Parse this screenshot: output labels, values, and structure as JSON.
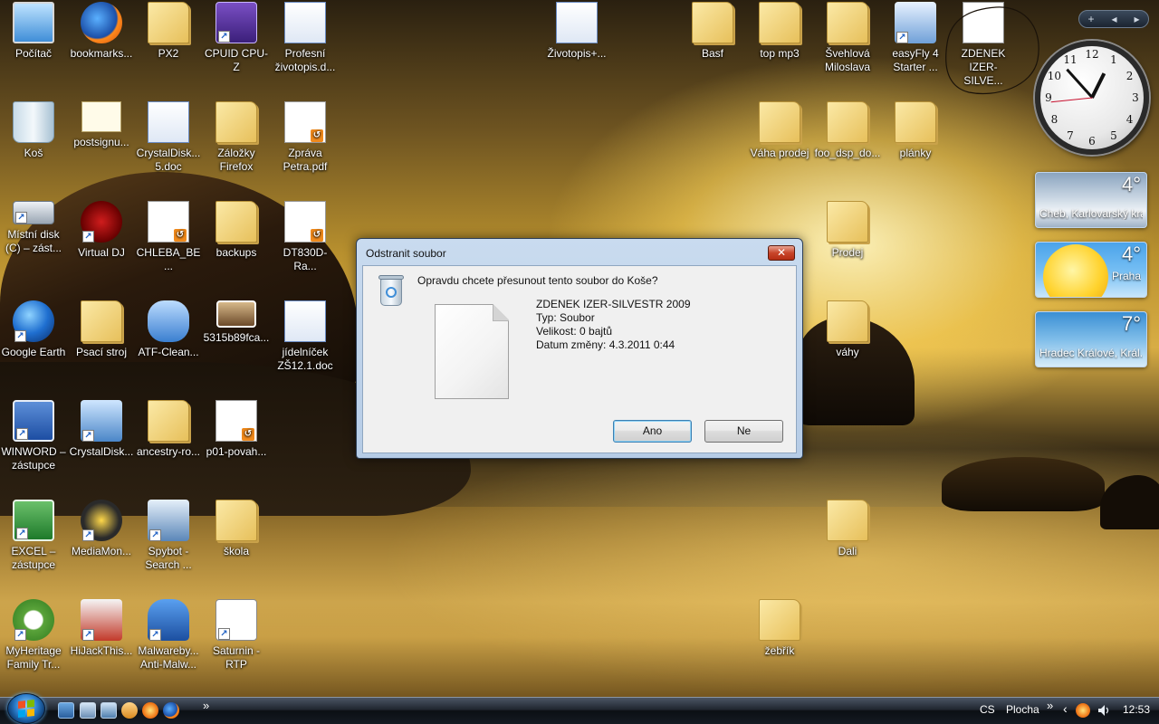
{
  "desktop": {
    "icons": [
      {
        "label": "Počítač",
        "icon": "computer-icon",
        "shortcut": false
      },
      {
        "label": "bookmarks...",
        "icon": "firefox-html-icon",
        "shortcut": false
      },
      {
        "label": "PX2",
        "icon": "folder-icon",
        "shortcut": false
      },
      {
        "label": "CPUID CPU-Z",
        "icon": "cpuz-icon",
        "shortcut": true
      },
      {
        "label": "Profesní životopis.d...",
        "icon": "word-doc-icon",
        "shortcut": false
      },
      {
        "label": "Koš",
        "icon": "recycle-bin-icon",
        "shortcut": false
      },
      {
        "label": "postsignu...",
        "icon": "certificate-icon",
        "shortcut": false
      },
      {
        "label": "CrystalDisk... 5.doc",
        "icon": "word-doc-icon",
        "shortcut": false
      },
      {
        "label": "Záložky Firefox",
        "icon": "folder-icon",
        "shortcut": false
      },
      {
        "label": "Zpráva Petra.pdf",
        "icon": "pdf-icon",
        "shortcut": false
      },
      {
        "label": "Místní disk (C) – zást...",
        "icon": "disk-icon",
        "shortcut": true
      },
      {
        "label": "Virtual DJ",
        "icon": "virtualdj-icon",
        "shortcut": true
      },
      {
        "label": "CHLEBA_BE...",
        "icon": "pdf-icon",
        "shortcut": false
      },
      {
        "label": "backups",
        "icon": "folder-icon",
        "shortcut": false
      },
      {
        "label": "DT830D-Ra...",
        "icon": "pdf-icon",
        "shortcut": false
      },
      {
        "label": "Google Earth",
        "icon": "google-earth-icon",
        "shortcut": true
      },
      {
        "label": "Psací stroj",
        "icon": "folder-icon",
        "shortcut": false
      },
      {
        "label": "ATF-Clean...",
        "icon": "atf-clean-icon",
        "shortcut": false
      },
      {
        "label": "5315b89fca...",
        "icon": "image-thumbnail-icon",
        "shortcut": false
      },
      {
        "label": "jídelníček ZŠ12.1.doc",
        "icon": "word-doc-icon",
        "shortcut": false
      },
      {
        "label": "WINWORD – zástupce",
        "icon": "word-app-icon",
        "shortcut": true
      },
      {
        "label": "CrystalDisk...",
        "icon": "crystaldisk-icon",
        "shortcut": true
      },
      {
        "label": "ancestry-ro...",
        "icon": "folder-icon",
        "shortcut": false
      },
      {
        "label": "p01-povah...",
        "icon": "pdf-icon",
        "shortcut": false
      },
      {
        "label": "EXCEL – zástupce",
        "icon": "excel-app-icon",
        "shortcut": true
      },
      {
        "label": "MediaMon...",
        "icon": "mediamonkey-icon",
        "shortcut": true
      },
      {
        "label": "Spybot - Search ...",
        "icon": "spybot-icon",
        "shortcut": true
      },
      {
        "label": "škola",
        "icon": "folder-icon",
        "shortcut": false
      },
      {
        "label": "MyHeritage Family Tr...",
        "icon": "myheritage-icon",
        "shortcut": true
      },
      {
        "label": "HiJackThis...",
        "icon": "hijackthis-icon",
        "shortcut": true
      },
      {
        "label": "Malwareby... Anti-Malw...",
        "icon": "malwarebytes-icon",
        "shortcut": true
      },
      {
        "label": "Saturnin - RTP",
        "icon": "saturnin-icon",
        "shortcut": true
      },
      {
        "label": "Životopis+...",
        "icon": "word-doc-icon",
        "shortcut": false
      },
      {
        "label": "Basf",
        "icon": "folder-icon",
        "shortcut": false
      },
      {
        "label": "top mp3",
        "icon": "folder-icon",
        "shortcut": false
      },
      {
        "label": "Švehlová Miloslava",
        "icon": "folder-icon",
        "shortcut": false
      },
      {
        "label": "easyFly 4 Starter ...",
        "icon": "easyfly-icon",
        "shortcut": true
      },
      {
        "label": "ZDENEK IZER-SILVE...",
        "icon": "blank-file-icon",
        "shortcut": false
      },
      {
        "label": "Váha prodej",
        "icon": "folder-icon",
        "shortcut": false
      },
      {
        "label": "foo_dsp_do...",
        "icon": "folder-icon",
        "shortcut": false
      },
      {
        "label": "plánky",
        "icon": "folder-icon",
        "shortcut": false
      },
      {
        "label": "Prodej",
        "icon": "folder-icon",
        "shortcut": false
      },
      {
        "label": "váhy",
        "icon": "folder-icon",
        "shortcut": false
      },
      {
        "label": "Dali",
        "icon": "folder-icon",
        "shortcut": false
      },
      {
        "label": "žebřík",
        "icon": "folder-icon",
        "shortcut": false
      }
    ]
  },
  "gadgets": {
    "toolbar": {
      "add": "+",
      "prev": "◂",
      "next": "▸"
    },
    "clock": {
      "hour": 12,
      "minute": 53,
      "second": 44,
      "numbers": [
        "12",
        "1",
        "2",
        "3",
        "4",
        "5",
        "6",
        "7",
        "8",
        "9",
        "10",
        "11"
      ]
    },
    "weather": [
      {
        "temp": "4°",
        "city": "Cheb, Karlovarský kraj",
        "icon": "cloudy-icon"
      },
      {
        "temp": "4°",
        "city": "Praha",
        "icon": "sunny-icon"
      },
      {
        "temp": "7°",
        "city": "Hradec Králové, Král...",
        "icon": "partly-cloudy-icon"
      }
    ]
  },
  "dialog": {
    "title": "Odstranit soubor",
    "close_label": "✕",
    "question": "Opravdu chcete přesunout tento soubor do Koše?",
    "file": {
      "name": "ZDENEK IZER-SILVESTR 2009",
      "type": "Typ: Soubor",
      "size": "Velikost: 0 bajtů",
      "modified": "Datum změny: 4.3.2011 0:44"
    },
    "yes_label": "Ano",
    "no_label": "Ne"
  },
  "taskbar": {
    "more_label": "»",
    "language": "CS",
    "desktop_label": "Plocha",
    "desktop_more": "»",
    "tray_arrow": "‹",
    "time": "12:53"
  },
  "colors": {
    "dialog_frame": "#c9dbef",
    "close_button": "#c8452a",
    "taskbar": "#151b22"
  }
}
